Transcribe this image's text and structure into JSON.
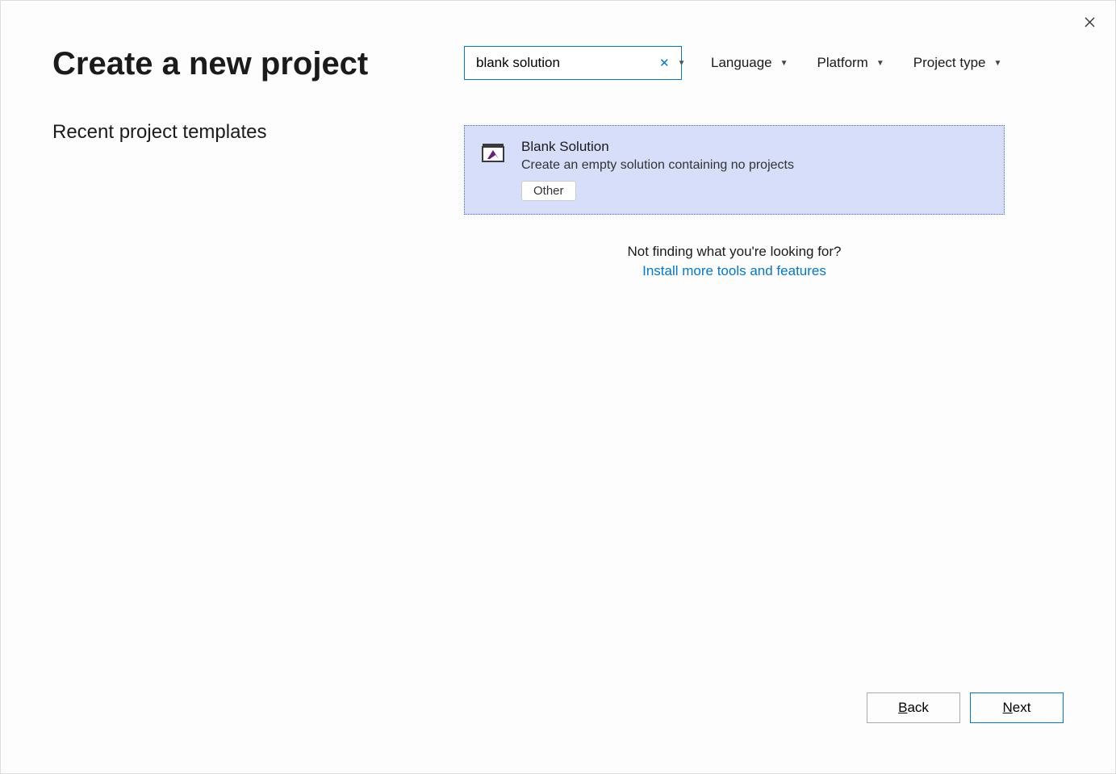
{
  "page_title": "Create a new project",
  "recent_heading": "Recent project templates",
  "search": {
    "value": "blank solution"
  },
  "filters": {
    "language": "Language",
    "platform": "Platform",
    "project_type": "Project type"
  },
  "template": {
    "title": "Blank Solution",
    "description": "Create an empty solution containing no projects",
    "tag": "Other"
  },
  "not_finding": {
    "question": "Not finding what you're looking for?",
    "link": "Install more tools and features"
  },
  "buttons": {
    "back_prefix": "B",
    "back_rest": "ack",
    "next_prefix": "N",
    "next_rest": "ext"
  }
}
